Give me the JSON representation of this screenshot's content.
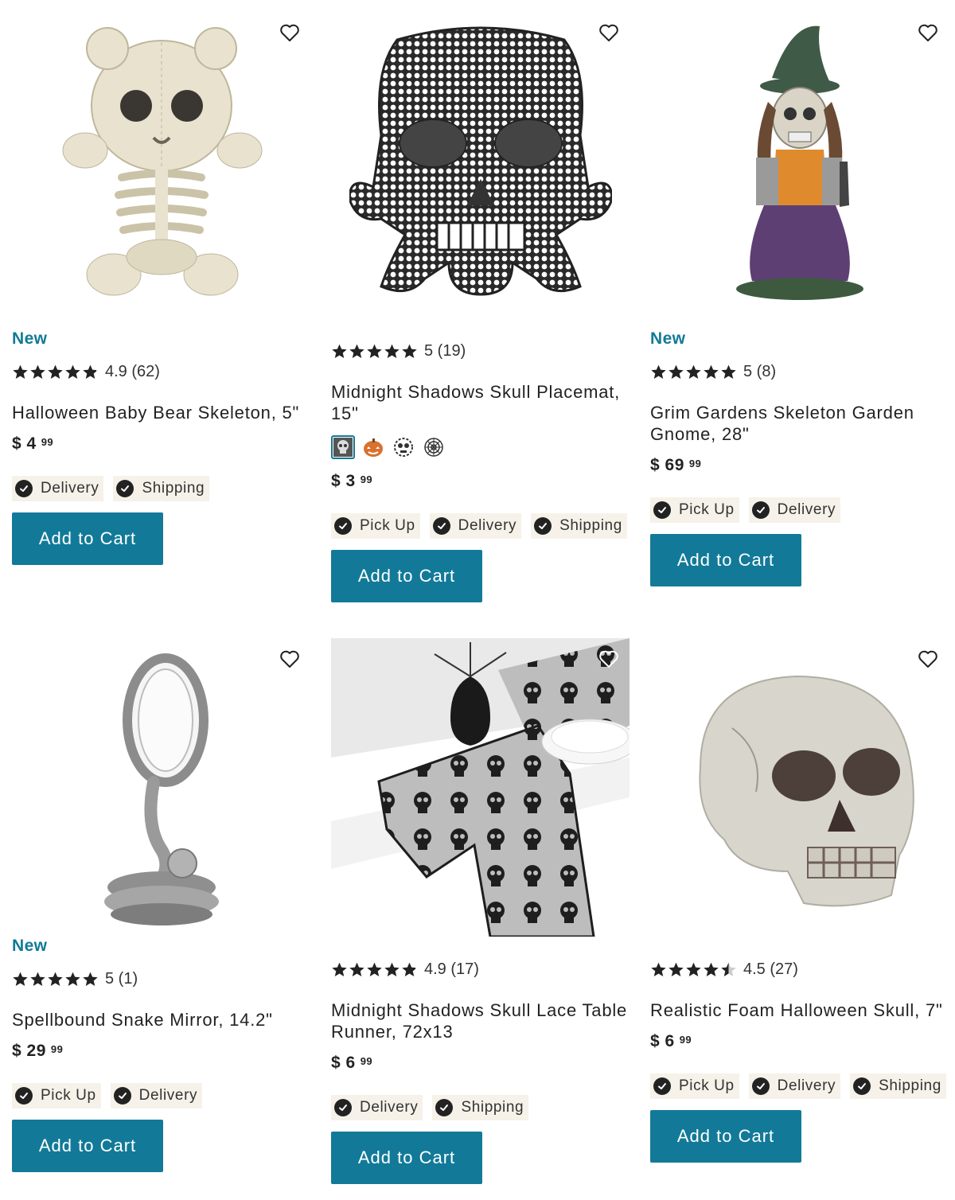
{
  "products": [
    {
      "badge": "New",
      "rating_value": 4.9,
      "rating_text": "4.9 (62)",
      "title": "Halloween Baby Bear Skeleton, 5\"",
      "price_dollars": "$ 4",
      "price_cents": "99",
      "fulfillment": [
        "Delivery",
        "Shipping"
      ],
      "button_label": "Add to Cart",
      "image_icon": "bear-skeleton-image"
    },
    {
      "badge": "",
      "rating_value": 5,
      "rating_text": "5 (19)",
      "title": "Midnight Shadows Skull Placemat, 15\"",
      "price_dollars": "$ 3",
      "price_cents": "99",
      "fulfillment": [
        "Pick Up",
        "Delivery",
        "Shipping"
      ],
      "button_label": "Add to Cart",
      "image_icon": "lace-skull-placemat-image",
      "swatches": [
        "skull-swatch",
        "pumpkin-swatch",
        "lace-swatch",
        "web-swatch"
      ]
    },
    {
      "badge": "New",
      "rating_value": 5,
      "rating_text": "5 (8)",
      "title": "Grim Gardens Skeleton Garden Gnome, 28\"",
      "price_dollars": "$ 69",
      "price_cents": "99",
      "fulfillment": [
        "Pick Up",
        "Delivery"
      ],
      "button_label": "Add to Cart",
      "image_icon": "skeleton-gnome-image"
    },
    {
      "badge": "New",
      "rating_value": 5,
      "rating_text": "5 (1)",
      "title": "Spellbound Snake Mirror, 14.2\"",
      "price_dollars": "$ 29",
      "price_cents": "99",
      "fulfillment": [
        "Pick Up",
        "Delivery"
      ],
      "button_label": "Add to Cart",
      "image_icon": "snake-mirror-image"
    },
    {
      "badge": "",
      "rating_value": 4.9,
      "rating_text": "4.9 (17)",
      "title": "Midnight Shadows Skull Lace Table Runner, 72x13",
      "price_dollars": "$ 6",
      "price_cents": "99",
      "fulfillment": [
        "Delivery",
        "Shipping"
      ],
      "button_label": "Add to Cart",
      "image_icon": "table-runner-image"
    },
    {
      "badge": "",
      "rating_value": 4.5,
      "rating_text": "4.5 (27)",
      "title": "Realistic Foam Halloween Skull, 7\"",
      "price_dollars": "$ 6",
      "price_cents": "99",
      "fulfillment": [
        "Pick Up",
        "Delivery",
        "Shipping"
      ],
      "button_label": "Add to Cart",
      "image_icon": "foam-skull-image"
    }
  ],
  "colors": {
    "accent": "#127a98",
    "chip_bg": "#f6f2e9",
    "star": "#222222"
  },
  "icons": {
    "wishlist": "heart-icon",
    "rating": "star-icon",
    "available": "check-icon"
  }
}
